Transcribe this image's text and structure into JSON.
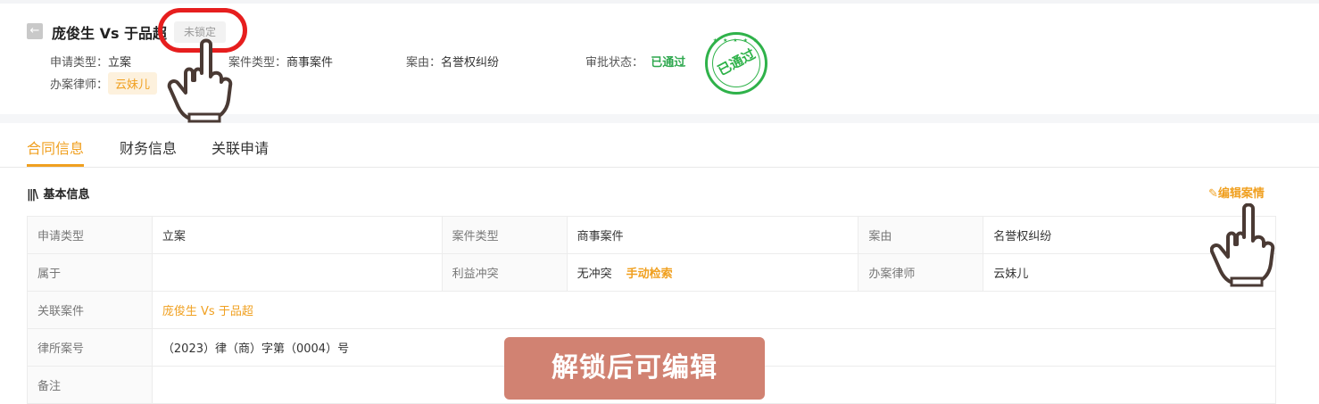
{
  "header": {
    "back_icon": "arrow-left-icon",
    "case_title": "庞俊生 Vs 于品超",
    "lock_status": "未锁定",
    "application_type_label": "申请类型：",
    "application_type_value": "立案",
    "case_type_label": "案件类型：",
    "case_type_value": "商事案件",
    "cause_label": "案由：",
    "cause_value": "名誉权纠纷",
    "approval_label": "审批状态：",
    "approval_value": "已通过",
    "lawyer_label": "办案律师：",
    "lawyer_value": "云妹儿",
    "stamp_text": "已通过"
  },
  "tabs": [
    {
      "label": "合同信息",
      "active": true
    },
    {
      "label": "财务信息",
      "active": false
    },
    {
      "label": "关联申请",
      "active": false
    }
  ],
  "section": {
    "title": "基本信息",
    "edit_label": "编辑案情"
  },
  "table": {
    "rows": [
      [
        "申请类型",
        "立案",
        "案件类型",
        "商事案件",
        "案由",
        "名誉权纠纷"
      ],
      [
        "属于",
        "",
        "利益冲突",
        "无冲突",
        "办案律师",
        "云妹儿"
      ],
      [
        "关联案件",
        "庞俊生 Vs 于品超"
      ],
      [
        "律所案号",
        "（2023）律（商）字第（0004）号"
      ],
      [
        "备注",
        ""
      ]
    ],
    "manual_search_label": "手动检索"
  },
  "overlay": {
    "banner_text": "解锁后可编辑"
  },
  "colors": {
    "accent": "#f0a020",
    "approved": "#2fa84f",
    "highlight_ring": "#e61e1e",
    "banner": "#d18272"
  }
}
